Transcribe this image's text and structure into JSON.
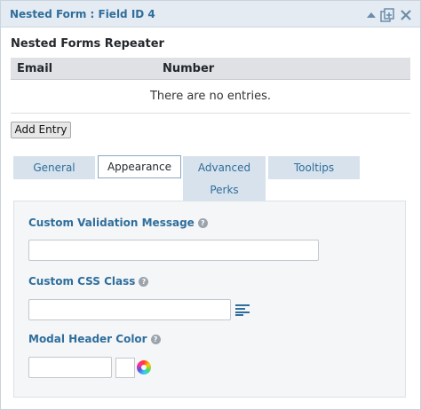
{
  "panel": {
    "title": "Nested Form : Field ID 4"
  },
  "repeater": {
    "title": "Nested Forms Repeater",
    "columns": [
      "Email",
      "Number"
    ],
    "empty_message": "There are no entries.",
    "add_button": "Add Entry"
  },
  "tabs": [
    {
      "label": "General",
      "active": false
    },
    {
      "label": "Appearance",
      "active": true
    },
    {
      "label": "Advanced",
      "active": false
    },
    {
      "label": "Tooltips",
      "active": false
    },
    {
      "label": "Perks",
      "active": false
    }
  ],
  "fields": {
    "validation": {
      "label": "Custom Validation Message",
      "value": ""
    },
    "css_class": {
      "label": "Custom CSS Class",
      "value": ""
    },
    "modal_color": {
      "label": "Modal Header Color",
      "value": ""
    }
  },
  "icons": {
    "collapse": "chevron-up-icon",
    "duplicate": "duplicate-icon",
    "delete": "close-icon",
    "help": "question-mark-icon",
    "merge_tags": "list-icon",
    "color_picker": "color-wheel-icon"
  },
  "colors": {
    "accent": "#2f6e9c",
    "header_bg": "#e4ebf2",
    "tab_bg": "#d7e2ec"
  }
}
